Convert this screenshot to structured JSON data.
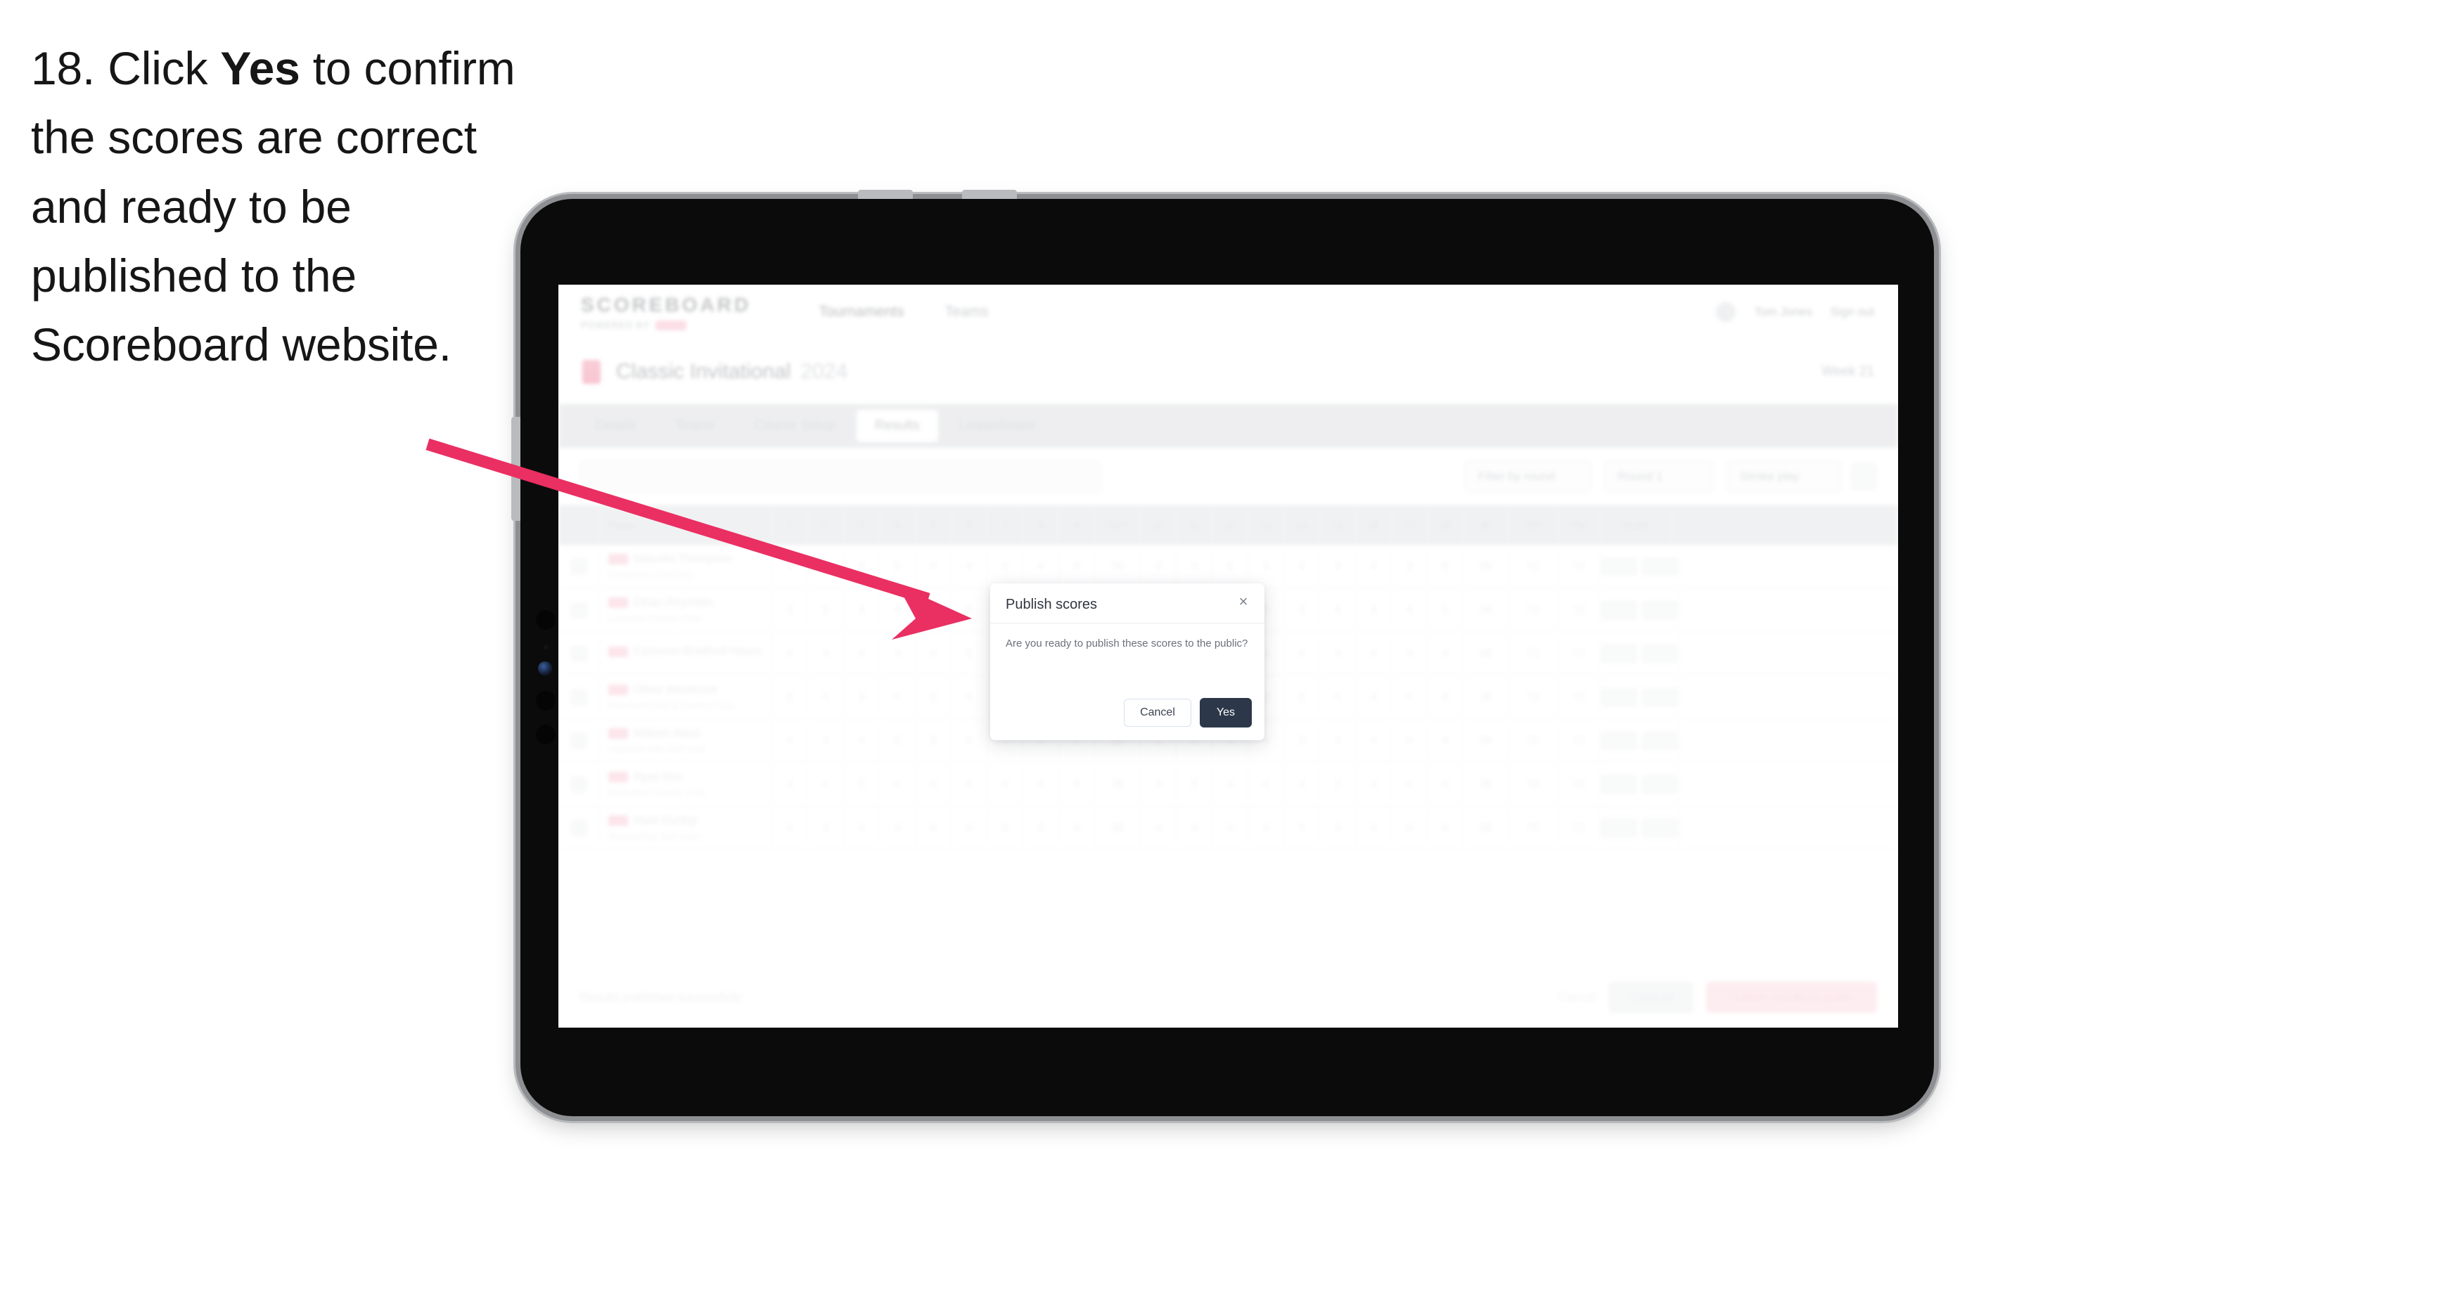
{
  "caption": {
    "step_number": "18.",
    "text_before": " Click ",
    "bold_word": "Yes",
    "text_after": " to confirm the scores are correct and ready to be published to the Scoreboard website.",
    "full_text": "18. Click Yes to confirm the scores are correct and ready to be published to the Scoreboard website."
  },
  "annotation": {
    "arrow_color": "#ea2f62",
    "points_to": "Yes button in Publish scores dialog"
  },
  "device": {
    "type": "tablet",
    "orientation": "landscape",
    "body_color": "#0b0b0c",
    "frame_color": "#b9bbbe"
  },
  "modal": {
    "title": "Publish scores",
    "close_icon": "×",
    "message": "Are you ready to publish these scores to the public?",
    "cancel_label": "Cancel",
    "confirm_label": "Yes",
    "confirm_color": "#2c3749"
  },
  "app": {
    "brand": {
      "word": "SCOREBOARD",
      "sub": "POWERED BY"
    },
    "top_nav": [
      "Tournaments",
      "Teams"
    ],
    "top_right": {
      "user": "Tom Jones",
      "signout": "Sign out"
    },
    "page_title": {
      "name": "Classic Invitational",
      "year": "2024",
      "right_meta": "Week 21"
    },
    "tabs": [
      {
        "label": "Details",
        "selected": false
      },
      {
        "label": "Teams",
        "selected": false
      },
      {
        "label": "Course Setup",
        "selected": false
      },
      {
        "label": "Results",
        "selected": true
      },
      {
        "label": "Leaderboard",
        "selected": false
      }
    ],
    "filters": {
      "search_placeholder": "Search",
      "filter_1": "Filter by round",
      "filter_2": "Round 1",
      "filter_3": "Stroke play"
    },
    "table": {
      "columns": [
        "",
        "Player",
        "1",
        "2",
        "3",
        "4",
        "5",
        "6",
        "7",
        "8",
        "9",
        "OUT",
        "10",
        "11",
        "12",
        "13",
        "14",
        "15",
        "16",
        "17",
        "18",
        "IN",
        "TOT",
        "Par",
        "Score"
      ],
      "rows": [
        {
          "flag": true,
          "name": "Malcolm Thompson",
          "club": "Grandview Golf Club",
          "holes": [
            "4",
            "4",
            "3",
            "5",
            "4",
            "4",
            "3",
            "4",
            "5"
          ],
          "out": "36",
          "holes_back": [
            "4",
            "4",
            "5",
            "3",
            "4",
            "4",
            "4",
            "3",
            "5"
          ],
          "in": "36",
          "tot": "72",
          "par": "72",
          "score": "E",
          "score2": "E"
        },
        {
          "flag": true,
          "name": "Ethan Reynolds",
          "club": "Lakeside Country Club",
          "holes": [
            "4",
            "5",
            "3",
            "4",
            "4",
            "5",
            "3",
            "4",
            "4"
          ],
          "out": "36",
          "holes_back": [
            "4",
            "3",
            "5",
            "4",
            "4",
            "4",
            "3",
            "4",
            "5"
          ],
          "in": "36",
          "tot": "72",
          "par": "72",
          "score": "E",
          "score2": "E"
        },
        {
          "flag": true,
          "name": "Cameron Bradford-Hayes",
          "club": "",
          "holes": [
            "4",
            "4",
            "4",
            "4",
            "4",
            "4",
            "4",
            "4",
            "4"
          ],
          "out": "36",
          "holes_back": [
            "4",
            "4",
            "4",
            "4",
            "4",
            "4",
            "4",
            "4",
            "4"
          ],
          "in": "36",
          "tot": "72",
          "par": "72",
          "score": "E",
          "score2": "E"
        },
        {
          "flag": true,
          "name": "Oliver Westmore",
          "club": "Riverbend Golf & Country Club",
          "holes": [
            "5",
            "4",
            "3",
            "4",
            "5",
            "4",
            "3",
            "4",
            "4"
          ],
          "out": "36",
          "holes_back": [
            "4",
            "4",
            "4",
            "3",
            "5",
            "4",
            "4",
            "4",
            "4"
          ],
          "in": "36",
          "tot": "72",
          "par": "72",
          "score": "E",
          "score2": "E"
        },
        {
          "flag": true,
          "name": "William Ward",
          "club": "Highland Hills Golf Club",
          "holes": [
            "4",
            "4",
            "4",
            "5",
            "3",
            "4",
            "4",
            "4",
            "4"
          ],
          "out": "36",
          "holes_back": [
            "5",
            "4",
            "4",
            "4",
            "3",
            "4",
            "4",
            "4",
            "4"
          ],
          "in": "36",
          "tot": "72",
          "par": "72",
          "score": "E",
          "score2": "E"
        },
        {
          "flag": true,
          "name": "Ryan Kim",
          "club": "Northgate Country Club",
          "holes": [
            "4",
            "4",
            "5",
            "4",
            "4",
            "3",
            "4",
            "4",
            "4"
          ],
          "out": "36",
          "holes_back": [
            "4",
            "5",
            "4",
            "4",
            "4",
            "3",
            "4",
            "4",
            "4"
          ],
          "in": "36",
          "tot": "72",
          "par": "72",
          "score": "E",
          "score2": "E"
        },
        {
          "flag": true,
          "name": "Mark Dunlop",
          "club": "Stonebridge Golf Links",
          "holes": [
            "4",
            "4",
            "4",
            "4",
            "4",
            "4",
            "5",
            "3",
            "4"
          ],
          "out": "36",
          "holes_back": [
            "4",
            "4",
            "4",
            "4",
            "5",
            "3",
            "4",
            "4",
            "4"
          ],
          "in": "36",
          "tot": "72",
          "par": "72",
          "score": "E",
          "score2": "E"
        }
      ]
    },
    "footer": {
      "note": "Results published successfully",
      "link": "Cancel",
      "button_secondary": "Save all",
      "button_primary": "Publish results to public"
    }
  }
}
